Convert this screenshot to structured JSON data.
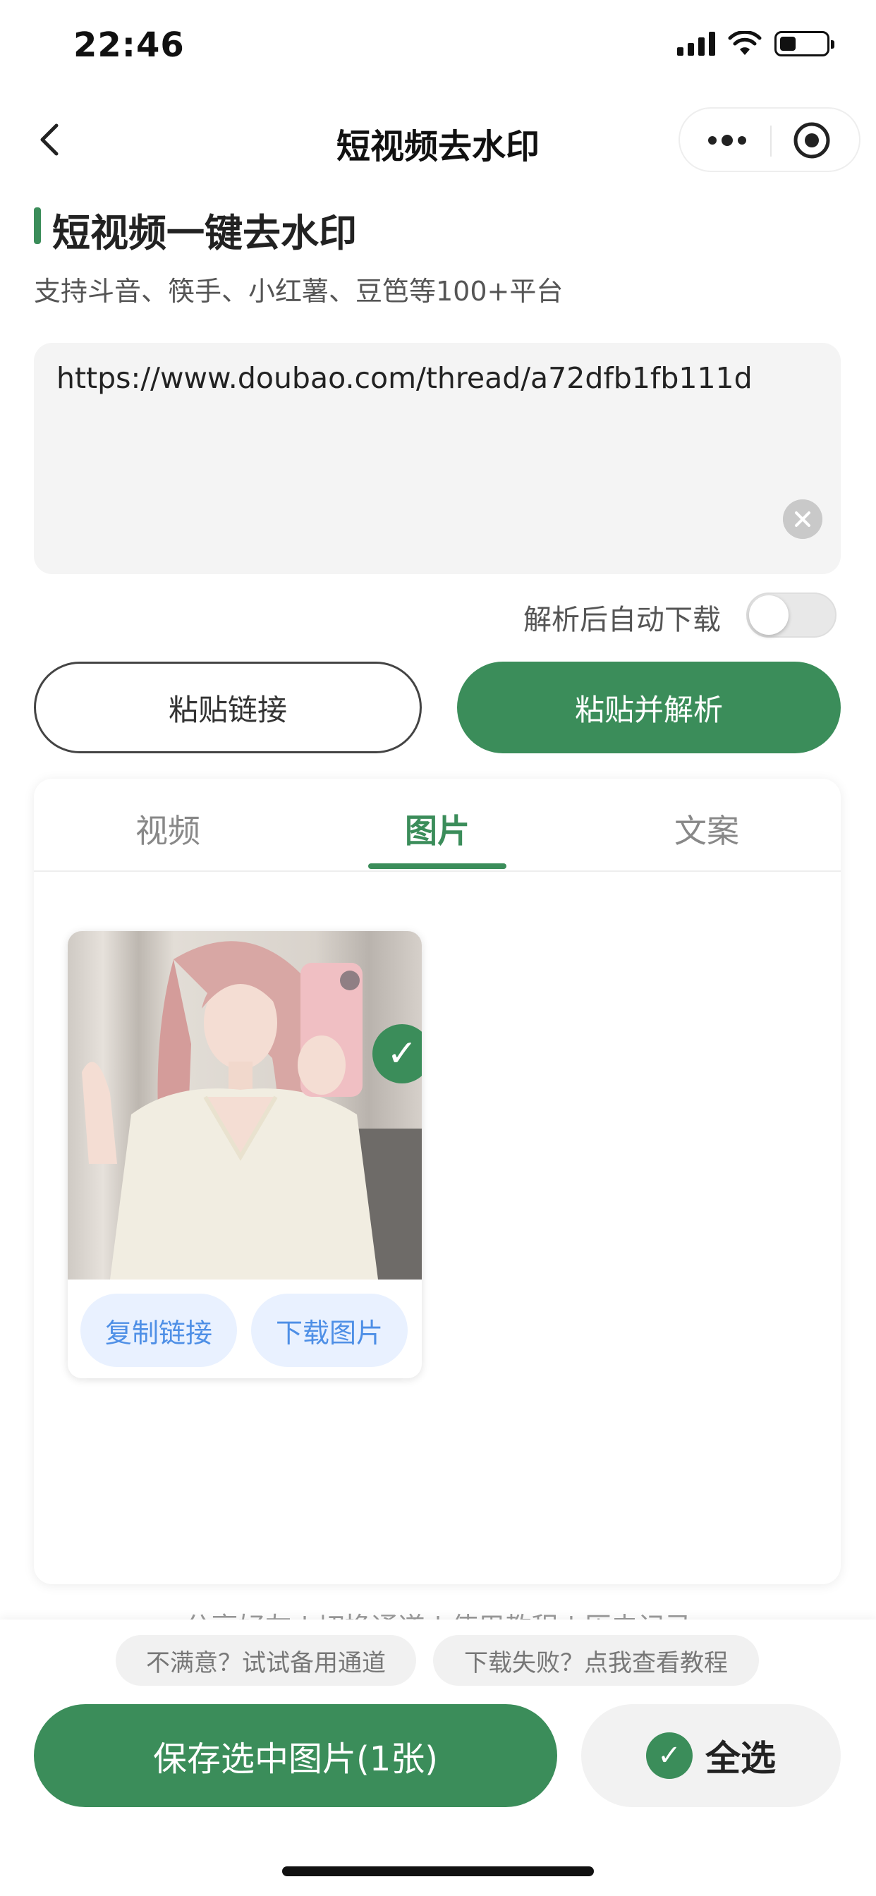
{
  "status_bar": {
    "time": "22:46"
  },
  "nav": {
    "title": "短视频去水印"
  },
  "header": {
    "title": "短视频一键去水印",
    "subtitle": "支持斗音、筷手、小红薯、豆笆等100+平台"
  },
  "input": {
    "value": "https://www.doubao.com/thread/a72dfb1fb111d"
  },
  "auto_download": {
    "label": "解析后自动下载",
    "enabled": false
  },
  "buttons": {
    "paste": "粘贴链接",
    "paste_parse": "粘贴并解析"
  },
  "tabs": [
    {
      "label": "视频",
      "active": false
    },
    {
      "label": "图片",
      "active": true
    },
    {
      "label": "文案",
      "active": false
    }
  ],
  "image_result": {
    "selected": true,
    "check_symbol": "✓",
    "copy_label": "复制链接",
    "download_label": "下载图片"
  },
  "footer_links": "分享好友 | 切换通道 | 使用教程 | 历史记录",
  "bottom": {
    "backup_hint": "不满意？试试备用通道",
    "help_hint": "下载失败？点我查看教程",
    "save_label": "保存选中图片(1张)",
    "select_all_label": "全选",
    "check_symbol": "✓"
  },
  "colors": {
    "primary": "#3b8d5a",
    "link_blue": "#4e8fe6",
    "link_bg": "#e9f1ff"
  }
}
